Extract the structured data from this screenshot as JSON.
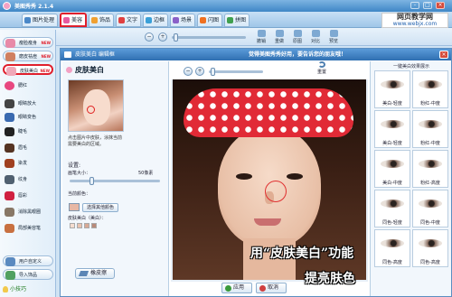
{
  "app": {
    "title": "美图秀秀 2.1.4",
    "window_controls": [
      "-",
      "□",
      "×"
    ]
  },
  "main_tabs": [
    {
      "label": "图片处理",
      "color": "#4a88c8"
    },
    {
      "label": "美容",
      "color": "#e65aa0",
      "active": true
    },
    {
      "label": "饰品",
      "color": "#f0a030"
    },
    {
      "label": "文字",
      "color": "#e04040"
    },
    {
      "label": "边框",
      "color": "#3aa0d8"
    },
    {
      "label": "场景",
      "color": "#8a60c8"
    },
    {
      "label": "闪图",
      "color": "#f07020"
    },
    {
      "label": "拼图",
      "color": "#40a050"
    }
  ],
  "watermark": {
    "line1": "网页教学网",
    "line2": "www.webjx.com"
  },
  "toolbar": {
    "zoom_in": "+",
    "zoom_out": "−",
    "buttons": [
      "撤销",
      "重做",
      "原图",
      "对比",
      "预览"
    ]
  },
  "sidebar": {
    "items": [
      {
        "label": "瘦脸瘦身",
        "new": "NEW",
        "icon": "face-slim-icon",
        "color": "#e88aa8"
      },
      {
        "label": "磨皮祛痘",
        "new": "NEW",
        "icon": "smooth-skin-icon",
        "color": "#d08060"
      },
      {
        "label": "皮肤美白",
        "new": "NEW",
        "icon": "skin-whiten-icon",
        "color": "#f0a8b8",
        "active": true
      },
      {
        "label": "腮红",
        "icon": "blush-icon",
        "color": "#e84880"
      },
      {
        "label": "眼睛放大",
        "icon": "eye-enlarge-icon",
        "color": "#444444"
      },
      {
        "label": "眼睛变色",
        "icon": "eye-color-icon",
        "color": "#3a6ab0"
      },
      {
        "label": "睫毛",
        "icon": "eyelash-icon",
        "color": "#222222"
      },
      {
        "label": "眉毛",
        "icon": "eyebrow-icon",
        "color": "#553322"
      },
      {
        "label": "染发",
        "icon": "hair-dye-icon",
        "color": "#a04020"
      },
      {
        "label": "纹身",
        "icon": "tattoo-icon",
        "color": "#506070"
      },
      {
        "label": "唇彩",
        "icon": "lip-icon",
        "color": "#d02040"
      },
      {
        "label": "消除黑眼圈",
        "icon": "dark-circle-icon",
        "color": "#887766"
      },
      {
        "label": "局部美容笔",
        "icon": "makeup-brush-icon",
        "color": "#c87040"
      },
      {
        "label": "用户自定义",
        "icon": "user-custom-icon",
        "color": "#5a8ac0"
      },
      {
        "label": "导入饰品",
        "icon": "import-icon",
        "color": "#50a060"
      }
    ]
  },
  "tip": {
    "label": "小技巧"
  },
  "dialog": {
    "title": "皮肤美白 编辑框",
    "promo": "觉得美图秀秀好用，要告诉您的朋友哦！",
    "close": "×",
    "panel_title": "皮肤美白",
    "description": "点击图片中皮肤，涂抹当前需要美白的区域。",
    "settings_label": "设置:",
    "brush_size_label": "画笔大小：",
    "brush_size_value": "50像素",
    "current_color_label": "当前颜色：",
    "pick_color_button": "选择其他颜色",
    "skin_tone_label": "皮肤美白（美白）：",
    "eraser_button": "橡皮擦",
    "reset_label": "重置",
    "ok_button": "应用",
    "cancel_button": "取消",
    "caption_line1": "用“皮肤美白”功能",
    "caption_line2": "提亮肤色",
    "effects_title": "一键美白效果展示",
    "effects": [
      "美白-轻度",
      "粉红-中度",
      "美白-轻度",
      "粉红-中度",
      "美白-中度",
      "粉红-高度",
      "同色-轻度",
      "同色-中度",
      "同色-高度",
      "同色-高度"
    ]
  },
  "colors": {
    "accent_red": "#e01f2c",
    "title_blue": "#3f86c6",
    "bow_red": "#e12a36"
  }
}
